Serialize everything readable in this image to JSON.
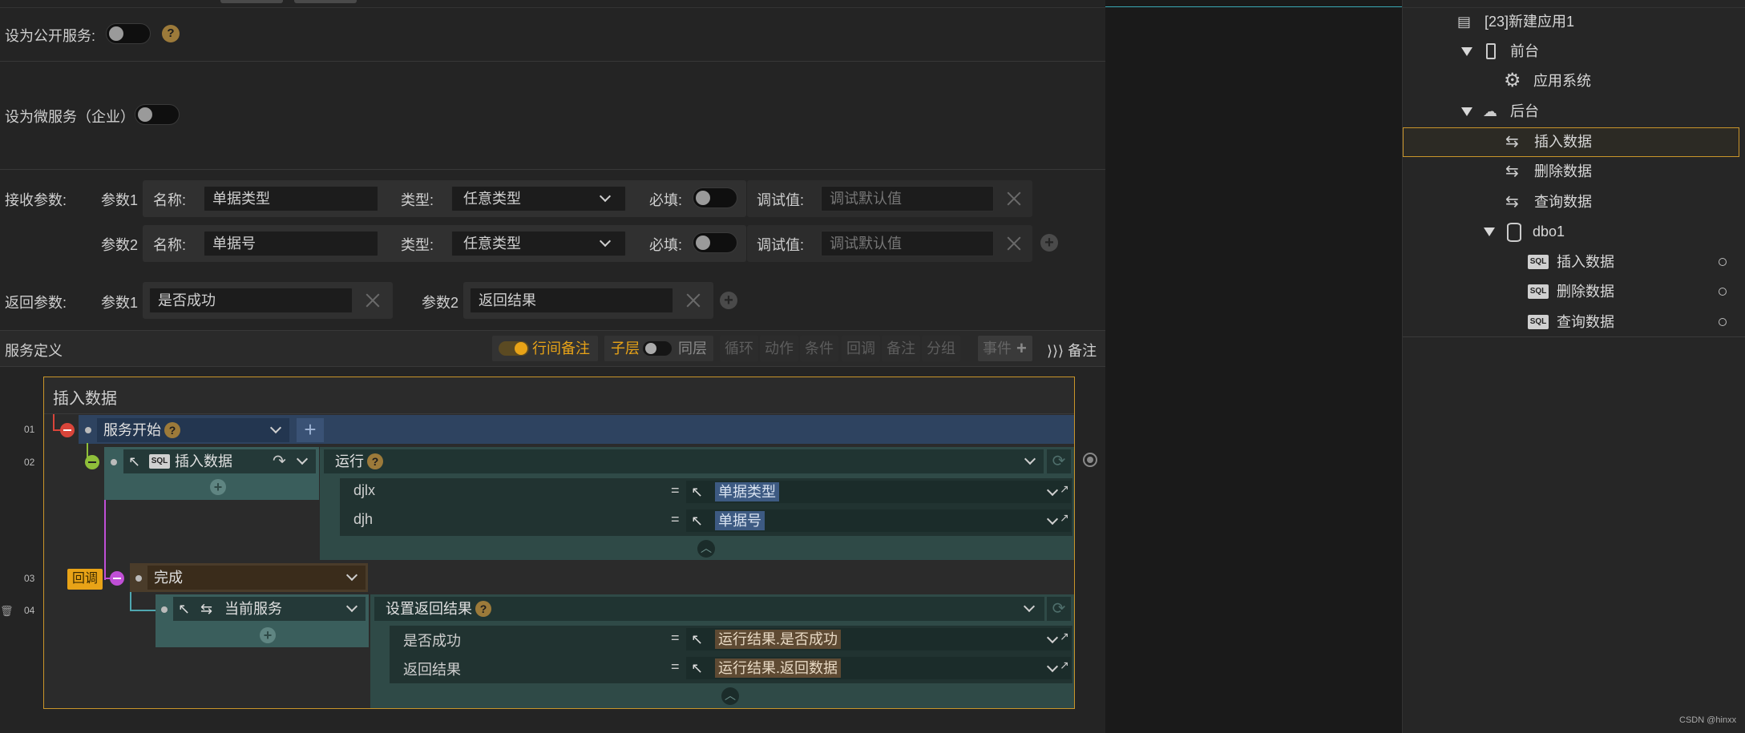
{
  "config": {
    "public_service_label": "设为公开服务:",
    "micro_service_label": "设为微服务（企业）",
    "help_mark": "?"
  },
  "receive": {
    "label": "接收参数:",
    "name_label": "名称:",
    "type_label": "类型:",
    "required_label": "必填:",
    "debug_label": "调试值:",
    "params": [
      {
        "id": "参数1",
        "name": "单据类型",
        "type": "任意类型",
        "debug_placeholder": "调试默认值"
      },
      {
        "id": "参数2",
        "name": "单据号",
        "type": "任意类型",
        "debug_placeholder": "调试默认值"
      }
    ]
  },
  "return": {
    "label": "返回参数:",
    "params": [
      {
        "id": "参数1",
        "value": "是否成功"
      },
      {
        "id": "参数2",
        "value": "返回结果"
      }
    ]
  },
  "toolbar": {
    "title": "服务定义",
    "inline_note": "行间备注",
    "child_layer": "子层",
    "same_layer": "同层",
    "loop": "循环",
    "action": "动作",
    "condition": "条件",
    "callback": "回调",
    "note": "备注",
    "group": "分组",
    "event": "事件",
    "note_right": "备注",
    "arrows": "⟩⟩⟩"
  },
  "flow": {
    "title": "插入数据",
    "lines": [
      "01",
      "02",
      "03",
      "04"
    ],
    "start": "服务开始",
    "insert": "插入数据",
    "run": "运行",
    "run_rows": [
      {
        "key": "djlx",
        "eq": "=",
        "value": "单据类型"
      },
      {
        "key": "djh",
        "eq": "=",
        "value": "单据号"
      }
    ],
    "callback_tag": "回调",
    "done": "完成",
    "current": "当前服务",
    "set_result": "设置返回结果",
    "result_rows": [
      {
        "key": "是否成功",
        "eq": "=",
        "value": "运行结果.是否成功"
      },
      {
        "key": "返回结果",
        "eq": "=",
        "value": "运行结果.返回数据"
      }
    ]
  },
  "tree": {
    "app": "[23]新建应用1",
    "front": "前台",
    "app_system": "应用系统",
    "back": "后台",
    "insert": "插入数据",
    "delete": "删除数据",
    "query": "查询数据",
    "db": "dbo1",
    "sql_insert": "插入数据",
    "sql_delete": "删除数据",
    "sql_query": "查询数据",
    "sql_badge": "SQL"
  },
  "watermark": "CSDN @hinxx",
  "colors": {
    "accent": "#e8a317",
    "flow_blue": "#2e4360",
    "flow_teal": "#2f4a47",
    "selected_border": "#c9952a"
  }
}
